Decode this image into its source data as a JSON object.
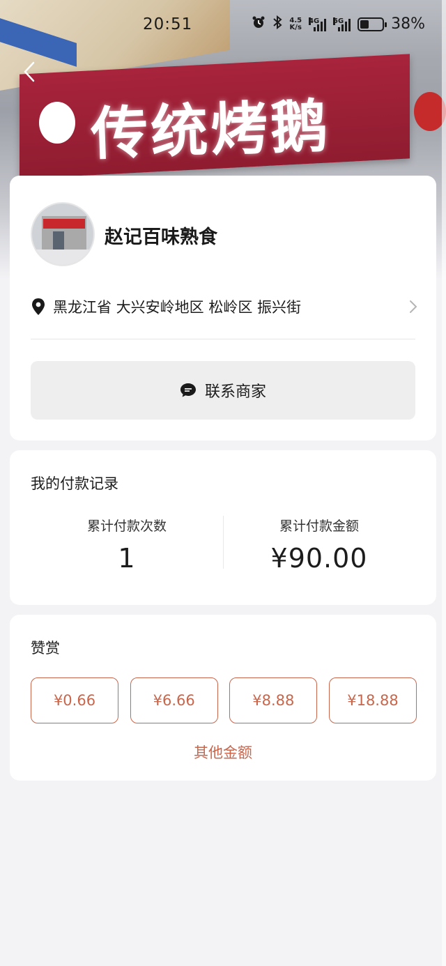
{
  "status_bar": {
    "time": "20:51",
    "net_speed_top": "4.5",
    "net_speed_bottom": "K/s",
    "sig1_label": "4G",
    "sig2_label": "5G",
    "battery": "38%"
  },
  "banner": {
    "sign_text": "传统烤鹅"
  },
  "merchant": {
    "name": "赵记百味熟食",
    "address": "黑龙江省 大兴安岭地区 松岭区 振兴街",
    "contact_label": "联系商家"
  },
  "payment_record": {
    "title": "我的付款记录",
    "count_label": "累计付款次数",
    "count_value": "1",
    "amount_label": "累计付款金额",
    "amount_value": "¥90.00"
  },
  "reward": {
    "title": "赞赏",
    "amounts": [
      "¥0.66",
      "¥6.66",
      "¥8.88",
      "¥18.88"
    ],
    "other_label": "其他金额"
  },
  "colors": {
    "accent": "#c8664c",
    "background": "#f3f3f6",
    "card": "#ffffff"
  }
}
